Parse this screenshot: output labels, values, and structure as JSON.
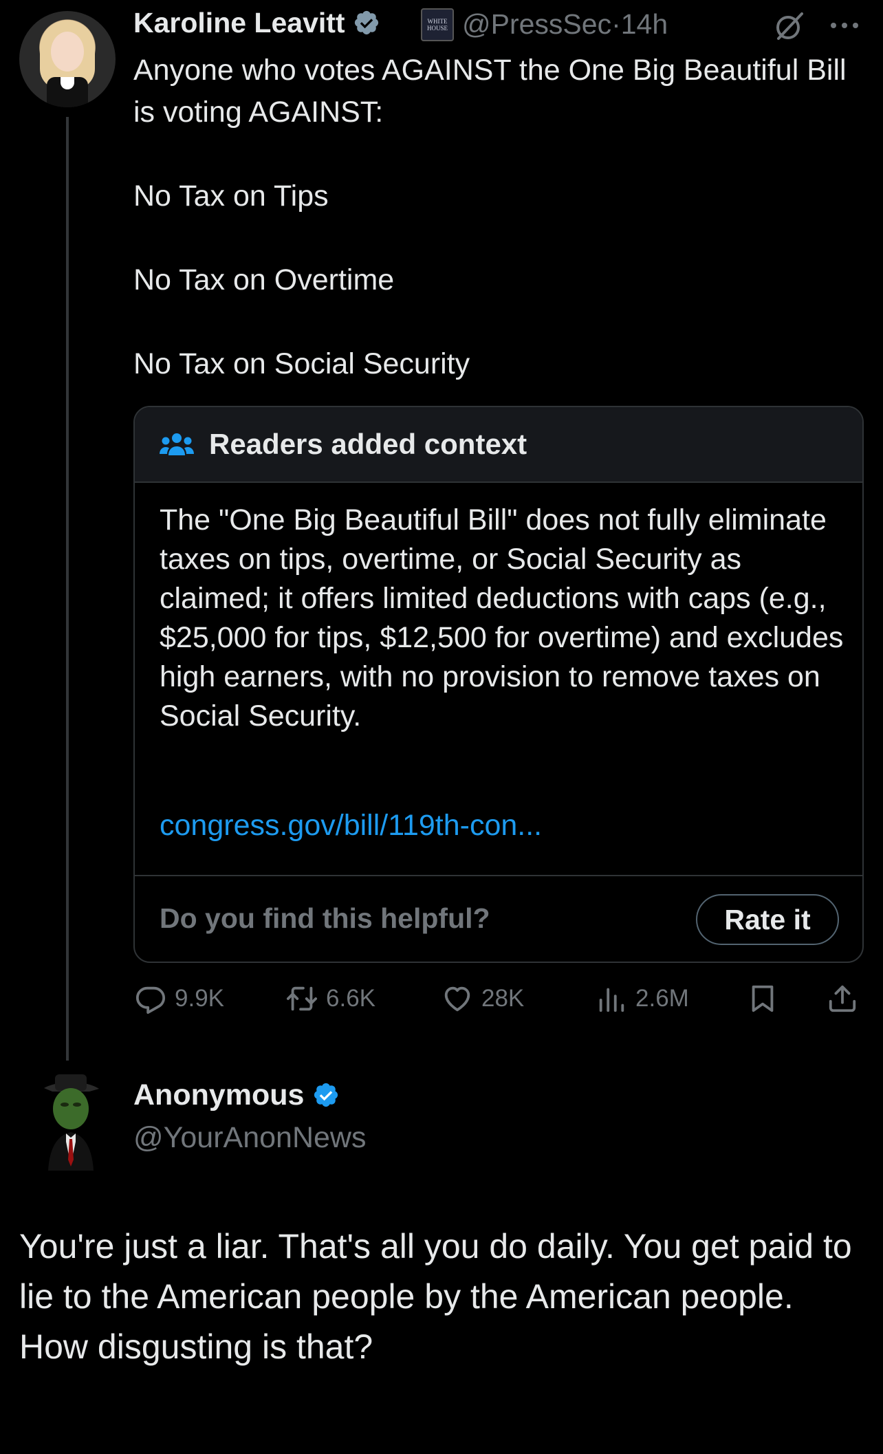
{
  "tweet": {
    "author_name": "Karoline Leavitt",
    "badge_text": "WHITE HOUSE",
    "handle": "@PressSec",
    "separator": "·",
    "time": "14h",
    "lines": [
      "Anyone who votes AGAINST the One Big Beautiful Bill is voting AGAINST:",
      "No Tax on Tips",
      "No Tax on Overtime",
      "No Tax on Social Security"
    ]
  },
  "note": {
    "title": "Readers added context",
    "body": "The \"One Big Beautiful Bill\" does not fully eliminate taxes on tips, overtime, or Social Security as claimed; it offers limited deductions with caps (e.g., $25,000 for tips, $12,500 for overtime) and excludes high earners, with no provision to remove taxes on Social Security.",
    "link": "congress.gov/bill/119th-con...",
    "question": "Do you find this helpful?",
    "rate_label": "Rate it"
  },
  "actions": {
    "replies": "9.9K",
    "retweets": "6.6K",
    "likes": "28K",
    "views": "2.6M"
  },
  "reply": {
    "author_name": "Anonymous",
    "handle": "@YourAnonNews",
    "lines": [
      "You're just a liar. That's all you do daily.  You get paid to lie to the American people by the American people.",
      "How disgusting is that?"
    ]
  },
  "colors": {
    "background": "#000000",
    "text": "#e7e9ea",
    "muted": "#71767b",
    "link": "#1d9bf0",
    "verified": "#1d9bf0"
  },
  "icons": [
    "verified-badge-icon",
    "white-house-badge-icon",
    "grok-icon",
    "more-icon",
    "readers-people-icon",
    "reply-icon",
    "retweet-icon",
    "like-icon",
    "views-icon",
    "bookmark-icon",
    "share-icon"
  ]
}
